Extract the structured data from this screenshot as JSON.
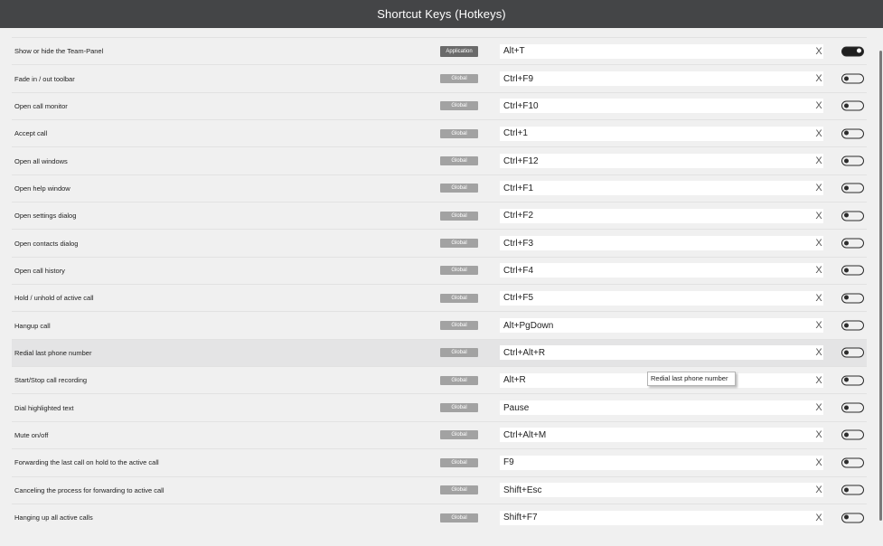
{
  "window": {
    "title": "Shortcut Keys (Hotkeys)"
  },
  "hotkeys": [
    {
      "label": "Show or hide the Team-Panel",
      "scope": "Application",
      "keys": "Alt+T",
      "enabled": true
    },
    {
      "label": "Fade in / out toolbar",
      "scope": "Global",
      "keys": "Ctrl+F9",
      "enabled": false
    },
    {
      "label": "Open call monitor",
      "scope": "Global",
      "keys": "Ctrl+F10",
      "enabled": false
    },
    {
      "label": "Accept call",
      "scope": "Global",
      "keys": "Ctrl+1",
      "enabled": false
    },
    {
      "label": "Open all windows",
      "scope": "Global",
      "keys": "Ctrl+F12",
      "enabled": false
    },
    {
      "label": "Open help window",
      "scope": "Global",
      "keys": "Ctrl+F1",
      "enabled": false
    },
    {
      "label": "Open settings dialog",
      "scope": "Global",
      "keys": "Ctrl+F2",
      "enabled": false
    },
    {
      "label": "Open contacts dialog",
      "scope": "Global",
      "keys": "Ctrl+F3",
      "enabled": false
    },
    {
      "label": "Open call history",
      "scope": "Global",
      "keys": "Ctrl+F4",
      "enabled": false
    },
    {
      "label": "Hold / unhold of active call",
      "scope": "Global",
      "keys": "Ctrl+F5",
      "enabled": false
    },
    {
      "label": "Hangup call",
      "scope": "Global",
      "keys": "Alt+PgDown",
      "enabled": false
    },
    {
      "label": "Redial last phone number",
      "scope": "Global",
      "keys": "Ctrl+Alt+R",
      "enabled": false
    },
    {
      "label": "Start/Stop call recording",
      "scope": "Global",
      "keys": "Alt+R",
      "enabled": false
    },
    {
      "label": "Dial highlighted text",
      "scope": "Global",
      "keys": "Pause",
      "enabled": false
    },
    {
      "label": "Mute on/off",
      "scope": "Global",
      "keys": "Ctrl+Alt+M",
      "enabled": false
    },
    {
      "label": "Forwarding the last call on hold to the active call",
      "scope": "Global",
      "keys": "F9",
      "enabled": false
    },
    {
      "label": "Canceling the process for forwarding to active call",
      "scope": "Global",
      "keys": "Shift+Esc",
      "enabled": false
    },
    {
      "label": "Hanging up all active calls",
      "scope": "Global",
      "keys": "Shift+F7",
      "enabled": false
    }
  ],
  "clear_glyph": "X",
  "hovered_row": 11,
  "tooltip": {
    "text": "Redial last phone number"
  },
  "icons": {
    "clear": "close-icon"
  },
  "colors": {
    "titlebar": "#444547",
    "scope_global": "#a2a2a2",
    "scope_application": "#6a6a6a",
    "toggle_on": "#1f1f1f"
  }
}
